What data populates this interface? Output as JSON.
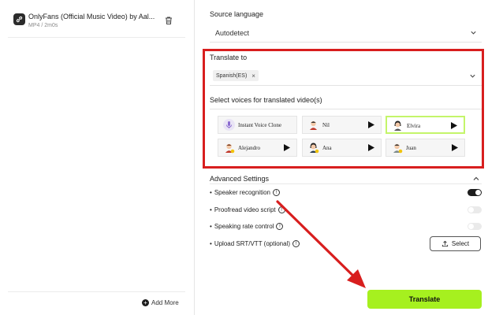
{
  "left_panel": {
    "file": {
      "title": "OnlyFans (Official Music Video) by Aal...",
      "meta": "MP4 / 2m0s"
    },
    "add_more_label": "Add More"
  },
  "source_language": {
    "label": "Source language",
    "value": "Autodetect"
  },
  "translate_to": {
    "label": "Translate to",
    "chip": "Spanish(ES)",
    "chip_remove": "×"
  },
  "voices": {
    "label": "Select voices for translated video(s)",
    "items": [
      {
        "name": "Instant Voice Clone",
        "avatar_icon": "voice-clone-icon",
        "has_play": false,
        "selected": false
      },
      {
        "name": "Nil",
        "avatar_icon": "male-avatar-icon",
        "has_play": true,
        "selected": false
      },
      {
        "name": "Elvira",
        "avatar_icon": "female-avatar-icon",
        "has_play": true,
        "selected": true
      },
      {
        "name": "Alejandro",
        "avatar_icon": "male-avatar-icon",
        "has_play": true,
        "selected": false
      },
      {
        "name": "Ana",
        "avatar_icon": "female-avatar-icon",
        "has_play": true,
        "selected": false
      },
      {
        "name": "Juan",
        "avatar_icon": "male-avatar-icon",
        "has_play": true,
        "selected": false
      }
    ],
    "selected_color": "#c4f56a"
  },
  "advanced": {
    "label": "Advanced Settings",
    "options": [
      {
        "label": "Speaker recognition",
        "toggle": "on"
      },
      {
        "label": "Proofread video script",
        "toggle": "off"
      },
      {
        "label": "Speaking rate control",
        "toggle": "off"
      },
      {
        "label": "Upload SRT/VTT (optional)",
        "toggle": null
      }
    ],
    "select_button": "Select"
  },
  "translate_button": {
    "label": "Translate",
    "color": "#a6f01f"
  },
  "annotation_color": "#d81e1e"
}
